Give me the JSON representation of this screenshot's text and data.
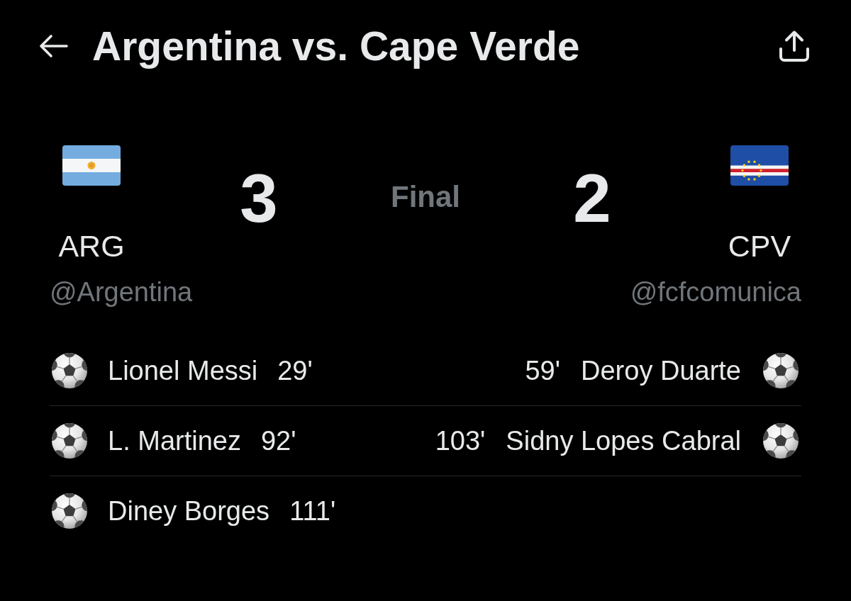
{
  "header": {
    "title": "Argentina vs. Cape Verde"
  },
  "match": {
    "status": "Final",
    "home": {
      "code": "ARG",
      "score": "3",
      "handle": "@Argentina"
    },
    "away": {
      "code": "CPV",
      "score": "2",
      "handle": "@fcfcomunica"
    }
  },
  "goal_rows": [
    {
      "home": {
        "player": "Lionel Messi",
        "minute": "29'"
      },
      "away": {
        "player": "Deroy Duarte",
        "minute": "59'"
      }
    },
    {
      "home": {
        "player": "L. Martinez",
        "minute": "92'"
      },
      "away": {
        "player": "Sidny Lopes Cabral",
        "minute": "103'"
      }
    },
    {
      "home": {
        "player": "Diney Borges",
        "minute": "111'"
      }
    }
  ]
}
